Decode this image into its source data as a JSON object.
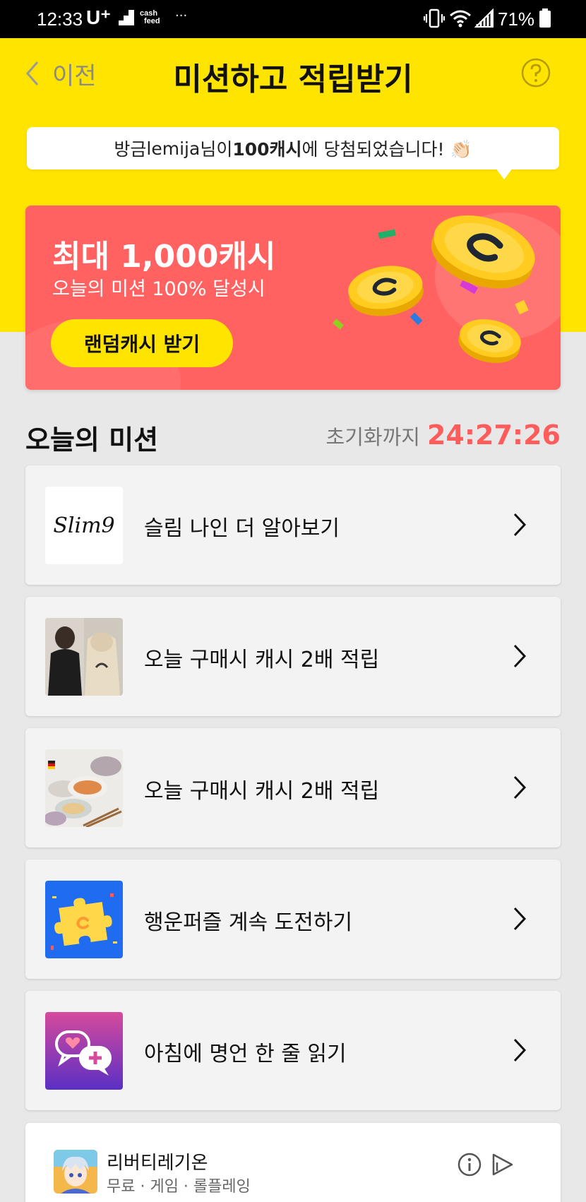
{
  "status_bar": {
    "time": "12:33",
    "carrier": "U⁺",
    "cashfeed_line1": "cash",
    "cashfeed_line2": "feed",
    "more": "···",
    "battery_percent": "71%"
  },
  "header": {
    "back_label": "이전",
    "title": "미션하고 적립받기",
    "help_icon": "question-circle-icon"
  },
  "notice": {
    "prefix": "방금 ",
    "user": "lemija",
    "middle": "님이 ",
    "amount": "100캐시",
    "suffix": "에 당첨되었습니다! 👏🏻"
  },
  "banner": {
    "title": "최대 1,000캐시",
    "subtitle": "오늘의 미션 100% 달성시",
    "button_label": "랜덤캐시 받기"
  },
  "missions_section": {
    "title": "오늘의 미션",
    "reset_label": "초기화까지",
    "reset_time": "24:27:26"
  },
  "missions": [
    {
      "label": "슬림 나인 더 알아보기",
      "thumb_text": "Slim9",
      "icon": "slim9-logo"
    },
    {
      "label": "오늘 구매시 캐시 2배 적립",
      "icon": "hoodie-product-thumb"
    },
    {
      "label": "오늘 구매시 캐시 2배 적립",
      "icon": "dish-set-product-thumb"
    },
    {
      "label": "행운퍼즐 계속 도전하기",
      "icon": "puzzle-icon"
    },
    {
      "label": "아침에 명언 한 줄 읽기",
      "icon": "chat-bubble-heart-icon"
    }
  ],
  "ad": {
    "title": "리버티레기온",
    "meta": "무료 · 게임 · 롤플레잉"
  },
  "colors": {
    "yellow": "#ffe400",
    "banner_red": "#ff6261",
    "timer_red": "#ff5c5c"
  }
}
